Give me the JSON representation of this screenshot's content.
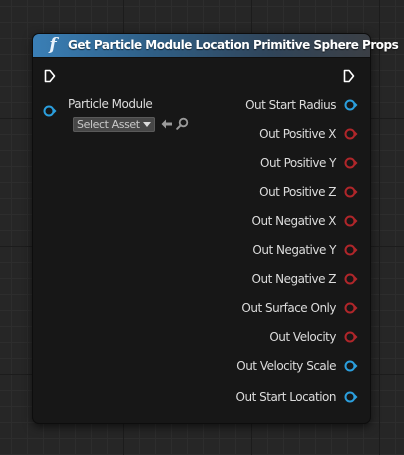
{
  "node": {
    "title": "Get Particle Module Location Primitive Sphere Props",
    "header_icon": "function-icon",
    "colors": {
      "header_start": "#3a7fb6",
      "body": "#171717",
      "pin_blue": "#2b9fde",
      "pin_red": "#b0262a",
      "exec": "#ffffff"
    },
    "inputs": [
      {
        "label": "Particle Module",
        "pin_color": "blue",
        "asset_picker": "Select Asset"
      }
    ],
    "outputs": [
      {
        "label": "Out Start Radius",
        "pin_color": "blue"
      },
      {
        "label": "Out Positive X",
        "pin_color": "red"
      },
      {
        "label": "Out Positive Y",
        "pin_color": "red"
      },
      {
        "label": "Out Positive Z",
        "pin_color": "red"
      },
      {
        "label": "Out Negative X",
        "pin_color": "red"
      },
      {
        "label": "Out Negative Y",
        "pin_color": "red"
      },
      {
        "label": "Out Negative Z",
        "pin_color": "red"
      },
      {
        "label": "Out Surface Only",
        "pin_color": "red"
      },
      {
        "label": "Out Velocity",
        "pin_color": "red"
      },
      {
        "label": "Out Velocity Scale",
        "pin_color": "blue"
      },
      {
        "label": "Out Start Location",
        "pin_color": "blue"
      }
    ]
  }
}
